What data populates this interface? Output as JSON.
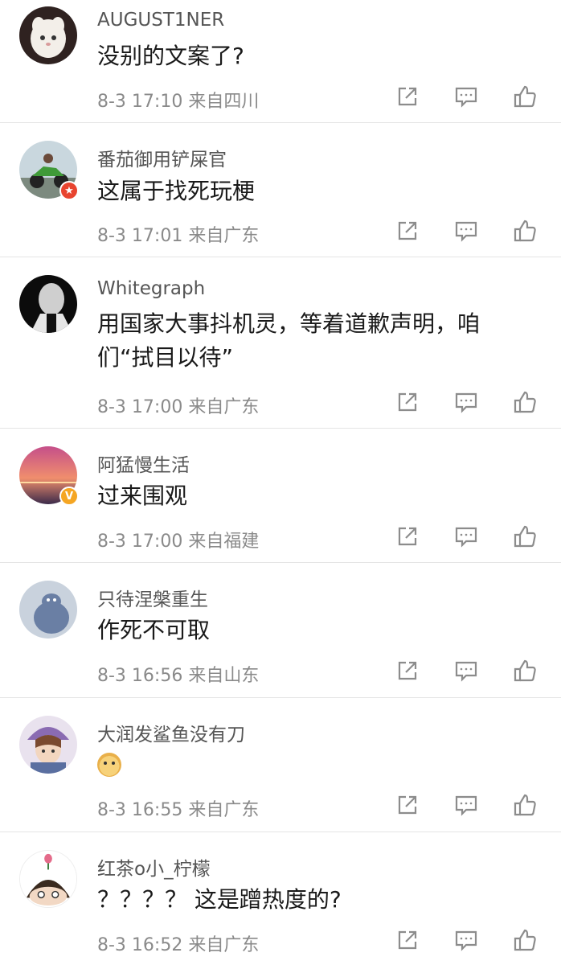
{
  "comments": [
    {
      "username": "AUGUST1NER",
      "text": "没别的文案了?",
      "meta": "8-3 17:10 来自四川",
      "avatar_colors": [
        "#3a2a25",
        "#f1ece6"
      ],
      "badge": ""
    },
    {
      "username": "番茄御用铲屎官",
      "text": "这属于找死玩梗",
      "meta": "8-3 17:01 来自广东",
      "avatar_colors": [
        "#c9d7de",
        "#3f8f3a"
      ],
      "badge": "red"
    },
    {
      "username": "Whitegraph",
      "text": "用国家大事抖机灵，等着道歉声明，咱们“拭目以待”",
      "meta": "8-3 17:00 来自广东",
      "avatar_colors": [
        "#0c0c0c",
        "#d9d9d9"
      ],
      "badge": ""
    },
    {
      "username": "阿猛慢生活",
      "text": "过来围观",
      "meta": "8-3 17:00 来自福建",
      "avatar_colors": [
        "#c54f8a",
        "#f3a36b"
      ],
      "badge": "gold"
    },
    {
      "username": "只待涅槃重生",
      "text": "作死不可取",
      "meta": "8-3 16:56 来自山东",
      "avatar_colors": [
        "#c9d2dd",
        "#6a7fa4"
      ],
      "badge": ""
    },
    {
      "username": "大润发鲨鱼没有刀",
      "text": "",
      "meta": "8-3 16:55 来自广东",
      "avatar_colors": [
        "#8a6bb2",
        "#d7b48a"
      ],
      "badge": "",
      "emoji": "doge-emoji"
    },
    {
      "username": "红茶o小_柠檬",
      "text": "？？？？ 这是蹭热度的?",
      "meta": "8-3 16:52 来自广东",
      "avatar_colors": [
        "#ffffff",
        "#3a2a1f"
      ],
      "badge": ""
    }
  ],
  "actions": {
    "repost_icon": "repost-icon",
    "comment_icon": "comment-icon",
    "like_icon": "like-icon",
    "icon_color": "#8c8c8c"
  }
}
